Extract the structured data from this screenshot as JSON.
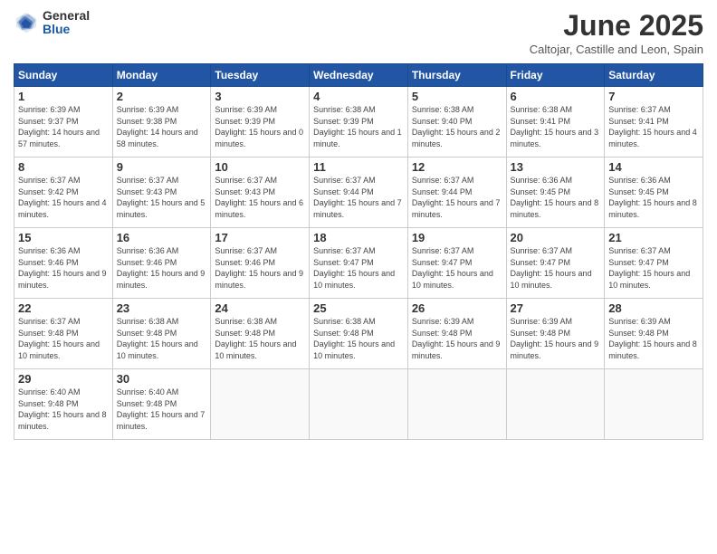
{
  "logo": {
    "general": "General",
    "blue": "Blue"
  },
  "title": "June 2025",
  "subtitle": "Caltojar, Castille and Leon, Spain",
  "headers": [
    "Sunday",
    "Monday",
    "Tuesday",
    "Wednesday",
    "Thursday",
    "Friday",
    "Saturday"
  ],
  "weeks": [
    [
      {
        "day": "1",
        "rise": "6:39 AM",
        "set": "9:37 PM",
        "daylight": "14 hours and 57 minutes."
      },
      {
        "day": "2",
        "rise": "6:39 AM",
        "set": "9:38 PM",
        "daylight": "14 hours and 58 minutes."
      },
      {
        "day": "3",
        "rise": "6:39 AM",
        "set": "9:39 PM",
        "daylight": "15 hours and 0 minutes."
      },
      {
        "day": "4",
        "rise": "6:38 AM",
        "set": "9:39 PM",
        "daylight": "15 hours and 1 minute."
      },
      {
        "day": "5",
        "rise": "6:38 AM",
        "set": "9:40 PM",
        "daylight": "15 hours and 2 minutes."
      },
      {
        "day": "6",
        "rise": "6:38 AM",
        "set": "9:41 PM",
        "daylight": "15 hours and 3 minutes."
      },
      {
        "day": "7",
        "rise": "6:37 AM",
        "set": "9:41 PM",
        "daylight": "15 hours and 4 minutes."
      }
    ],
    [
      {
        "day": "8",
        "rise": "6:37 AM",
        "set": "9:42 PM",
        "daylight": "15 hours and 4 minutes."
      },
      {
        "day": "9",
        "rise": "6:37 AM",
        "set": "9:43 PM",
        "daylight": "15 hours and 5 minutes."
      },
      {
        "day": "10",
        "rise": "6:37 AM",
        "set": "9:43 PM",
        "daylight": "15 hours and 6 minutes."
      },
      {
        "day": "11",
        "rise": "6:37 AM",
        "set": "9:44 PM",
        "daylight": "15 hours and 7 minutes."
      },
      {
        "day": "12",
        "rise": "6:37 AM",
        "set": "9:44 PM",
        "daylight": "15 hours and 7 minutes."
      },
      {
        "day": "13",
        "rise": "6:36 AM",
        "set": "9:45 PM",
        "daylight": "15 hours and 8 minutes."
      },
      {
        "day": "14",
        "rise": "6:36 AM",
        "set": "9:45 PM",
        "daylight": "15 hours and 8 minutes."
      }
    ],
    [
      {
        "day": "15",
        "rise": "6:36 AM",
        "set": "9:46 PM",
        "daylight": "15 hours and 9 minutes."
      },
      {
        "day": "16",
        "rise": "6:36 AM",
        "set": "9:46 PM",
        "daylight": "15 hours and 9 minutes."
      },
      {
        "day": "17",
        "rise": "6:37 AM",
        "set": "9:46 PM",
        "daylight": "15 hours and 9 minutes."
      },
      {
        "day": "18",
        "rise": "6:37 AM",
        "set": "9:47 PM",
        "daylight": "15 hours and 10 minutes."
      },
      {
        "day": "19",
        "rise": "6:37 AM",
        "set": "9:47 PM",
        "daylight": "15 hours and 10 minutes."
      },
      {
        "day": "20",
        "rise": "6:37 AM",
        "set": "9:47 PM",
        "daylight": "15 hours and 10 minutes."
      },
      {
        "day": "21",
        "rise": "6:37 AM",
        "set": "9:47 PM",
        "daylight": "15 hours and 10 minutes."
      }
    ],
    [
      {
        "day": "22",
        "rise": "6:37 AM",
        "set": "9:48 PM",
        "daylight": "15 hours and 10 minutes."
      },
      {
        "day": "23",
        "rise": "6:38 AM",
        "set": "9:48 PM",
        "daylight": "15 hours and 10 minutes."
      },
      {
        "day": "24",
        "rise": "6:38 AM",
        "set": "9:48 PM",
        "daylight": "15 hours and 10 minutes."
      },
      {
        "day": "25",
        "rise": "6:38 AM",
        "set": "9:48 PM",
        "daylight": "15 hours and 10 minutes."
      },
      {
        "day": "26",
        "rise": "6:39 AM",
        "set": "9:48 PM",
        "daylight": "15 hours and 9 minutes."
      },
      {
        "day": "27",
        "rise": "6:39 AM",
        "set": "9:48 PM",
        "daylight": "15 hours and 9 minutes."
      },
      {
        "day": "28",
        "rise": "6:39 AM",
        "set": "9:48 PM",
        "daylight": "15 hours and 8 minutes."
      }
    ],
    [
      {
        "day": "29",
        "rise": "6:40 AM",
        "set": "9:48 PM",
        "daylight": "15 hours and 8 minutes."
      },
      {
        "day": "30",
        "rise": "6:40 AM",
        "set": "9:48 PM",
        "daylight": "15 hours and 7 minutes."
      },
      null,
      null,
      null,
      null,
      null
    ]
  ]
}
